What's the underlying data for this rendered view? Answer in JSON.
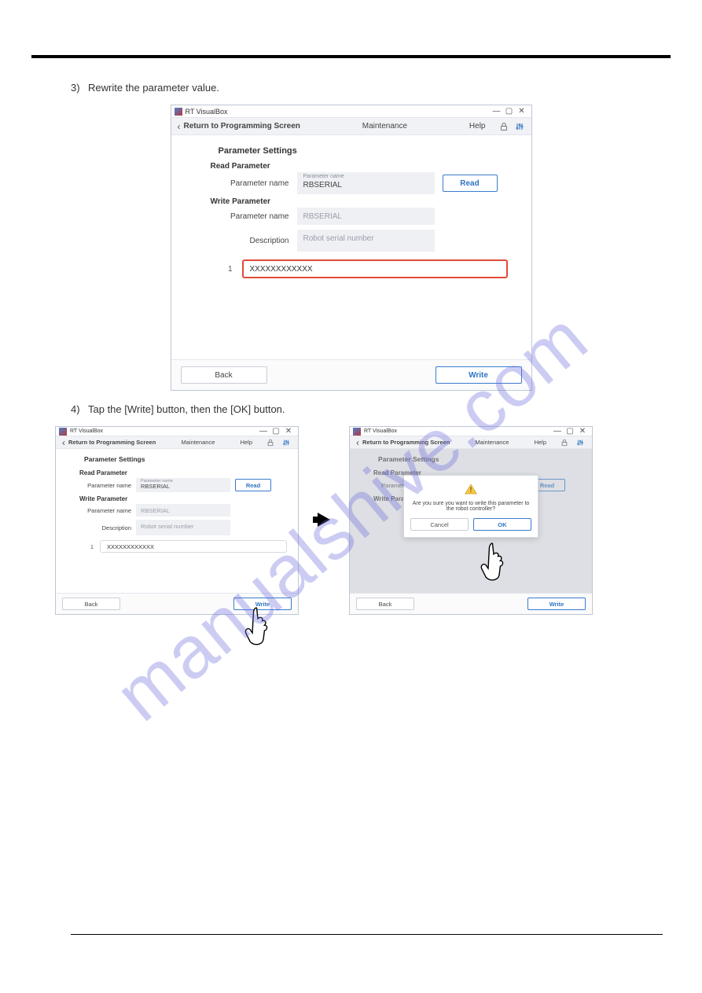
{
  "watermark": "manualshive.com",
  "step3": "3) Rewrite the parameter value.",
  "step4": "4) Tap the [Write] button, then the [OK] button.",
  "app": {
    "title": "RT VisualBox",
    "back_link": "Return to Programming Screen",
    "page_title": "Maintenance",
    "help": "Help"
  },
  "form": {
    "section_title": "Parameter Settings",
    "read_heading": "Read Parameter",
    "param_name_label": "Parameter name",
    "param_name_tiny": "Parameter name",
    "param_name_value": "RBSERIAL",
    "read_btn": "Read",
    "write_heading": "Write Parameter",
    "write_param_value": "RBSERIAL",
    "desc_label": "Description",
    "desc_value": "Robot serial number",
    "value_index": "1",
    "value_text": "XXXXXXXXXXXX"
  },
  "buttons": {
    "back": "Back",
    "write": "Write"
  },
  "modal": {
    "message": "Are you sure you want to write this parameter to the robot controller?",
    "cancel": "Cancel",
    "ok": "OK"
  }
}
